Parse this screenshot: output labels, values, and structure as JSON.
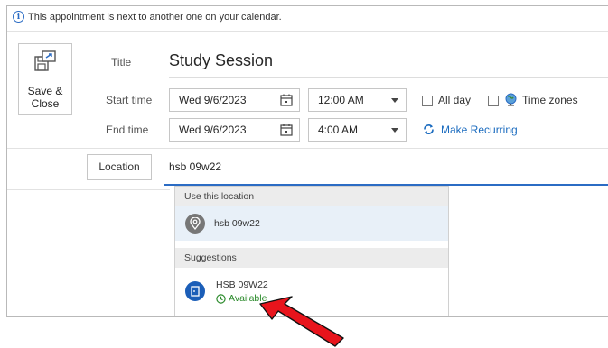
{
  "info_bar": {
    "message": "This appointment is next to another one on your calendar."
  },
  "save_close": {
    "label_line1": "Save &",
    "label_line2": "Close"
  },
  "title": {
    "label": "Title",
    "value": "Study Session"
  },
  "start": {
    "label": "Start time",
    "date": "Wed 9/6/2023",
    "time": "12:00 AM"
  },
  "end": {
    "label": "End time",
    "date": "Wed 9/6/2023",
    "time": "4:00 AM"
  },
  "options": {
    "all_day": "All day",
    "time_zones": "Time zones",
    "make_recurring": "Make Recurring"
  },
  "location": {
    "button_label": "Location",
    "value": "hsb 09w22"
  },
  "dropdown": {
    "use_header": "Use this location",
    "use_item": "hsb 09w22",
    "suggestions_header": "Suggestions",
    "suggestion_name": "HSB 09W22",
    "suggestion_status": "Available"
  },
  "colors": {
    "accent": "#2b6cc4",
    "available": "#2a8a2a",
    "arrow": "#e8141c"
  }
}
